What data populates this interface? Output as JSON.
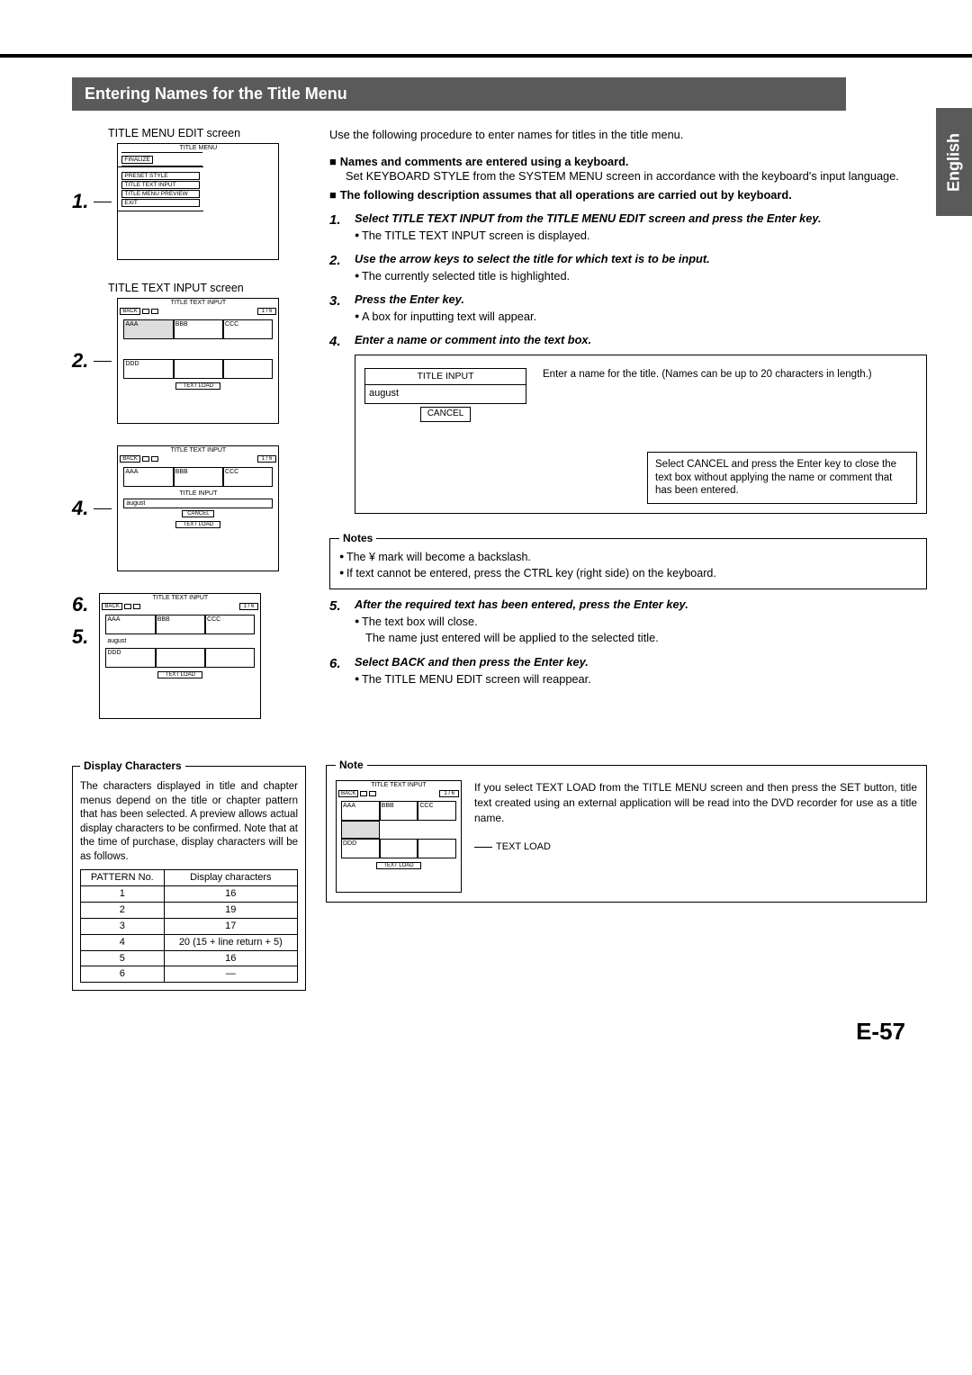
{
  "language_tab": "English",
  "header": "Entering Names for the Title Menu",
  "page_number": "E-57",
  "left": {
    "edit_label": "TITLE MENU EDIT screen",
    "input_label": "TITLE TEXT INPUT screen",
    "title_menu": "TITLE MENU",
    "finalize": "FINALIZE",
    "preset_style": "PRESET STYLE",
    "title_text_input": "TITLE TEXT INPUT",
    "title_menu_preview": "TITLE MENU PREVIEW",
    "exit": "EXIT",
    "tti_header": "TITLE TEXT INPUT",
    "back": "BACK",
    "page_ind": "1 / 6",
    "aaa": "AAA",
    "bbb": "BBB",
    "ccc": "CCC",
    "ddd": "DDD",
    "text_load": "TEXT LOAD",
    "title_input": "TITLE INPUT",
    "august": "august",
    "cancel": "CANCEL"
  },
  "nums": {
    "n1": "1.",
    "n2": "2.",
    "n4": "4.",
    "n5": "5.",
    "n6": "6."
  },
  "right": {
    "intro": "Use the following procedure to enter names for titles in the title menu.",
    "sq1": "Names and comments are entered using a keyboard.",
    "sq1_sub": "Set KEYBOARD STYLE from the SYSTEM MENU screen in accordance with the keyboard's input language.",
    "sq2": "The following description assumes that all operations are carried out by keyboard.",
    "s1": "Select TITLE TEXT INPUT from the TITLE MENU EDIT screen and press the Enter key.",
    "s1b": "The TITLE TEXT INPUT screen is displayed.",
    "s2": "Use the arrow keys to select the title for which text is to be input.",
    "s2b": "The currently selected title is highlighted.",
    "s3": "Press the Enter key.",
    "s3b": "A box for inputting text will appear.",
    "s4": "Enter a name or comment into the text box.",
    "d4_title": "TITLE INPUT",
    "d4_input": "august",
    "d4_cancel": "CANCEL",
    "d4_hint": "Enter a name for the title. (Names can be up to 20 characters in length.)",
    "d4_note": "Select CANCEL and press the Enter key to close the text box without applying the name or comment that has been entered.",
    "notes_legend": "Notes",
    "note_a": "The ¥ mark will become a backslash.",
    "note_b": "If text cannot be entered, press the CTRL key (right side) on the keyboard.",
    "s5": "After the required text has been entered, press the Enter key.",
    "s5b1": "The text box will close.",
    "s5b2": "The name just entered will be applied to the selected title.",
    "s6": "Select BACK and then press the Enter key.",
    "s6b": "The TITLE MENU EDIT screen will reappear."
  },
  "dc": {
    "legend": "Display Characters",
    "text": "The characters displayed in title and chapter menus depend on the title or chapter pattern that has been selected. A preview allows actual display characters to be confirmed. Note that at the time of purchase, display characters will be as follows.",
    "th1": "PATTERN No.",
    "th2": "Display characters",
    "rows": [
      {
        "p": "1",
        "d": "16"
      },
      {
        "p": "2",
        "d": "19"
      },
      {
        "p": "3",
        "d": "17"
      },
      {
        "p": "4",
        "d": "20 (15 + line return + 5)"
      },
      {
        "p": "5",
        "d": "16"
      },
      {
        "p": "6",
        "d": "—"
      }
    ]
  },
  "note2": {
    "legend": "Note",
    "text": "If you select TEXT LOAD from the TITLE MENU screen and then press the SET button, title text created using an external application will be read into the DVD recorder for use as a title name.",
    "label": "TEXT LOAD"
  }
}
